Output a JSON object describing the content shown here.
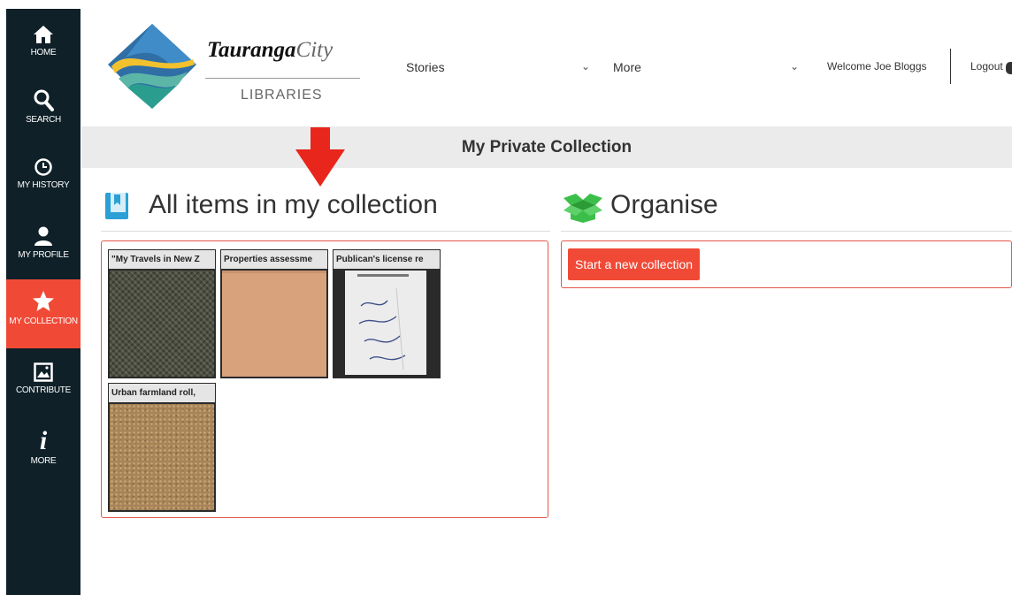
{
  "sidebar": {
    "items": [
      {
        "label": "HOME",
        "icon": "home-icon"
      },
      {
        "label": "SEARCH",
        "icon": "search-icon"
      },
      {
        "label": "MY HISTORY",
        "icon": "clock-icon"
      },
      {
        "label": "MY PROFILE",
        "icon": "user-icon"
      },
      {
        "label": "MY COLLECTION",
        "icon": "star-icon",
        "active": true
      },
      {
        "label": "CONTRIBUTE",
        "icon": "image-icon"
      },
      {
        "label": "MORE",
        "icon": "info-icon"
      }
    ],
    "active_color": "#f04a37",
    "background": "#0f2028"
  },
  "header": {
    "logo": {
      "name": "Tauranga",
      "city": "City",
      "sub": "LIBRARIES"
    },
    "nav": [
      {
        "label": "Stories",
        "has_dropdown": true
      },
      {
        "label": "More",
        "has_dropdown": true
      }
    ],
    "chevron": "⌄",
    "welcome": "Welcome Joe Bloggs",
    "logout": "Logout"
  },
  "page_title": "My Private Collection",
  "collection": {
    "heading": "All items in my collection",
    "items": [
      {
        "title": "\"My Travels in New Z"
      },
      {
        "title": "Properties assessme"
      },
      {
        "title": "Publican's license re"
      },
      {
        "title": "Urban farmland roll,"
      }
    ]
  },
  "organise": {
    "heading": "Organise",
    "button": "Start a new collection"
  },
  "accent_color": "#f04a37",
  "arrow_color": "#e8261c"
}
